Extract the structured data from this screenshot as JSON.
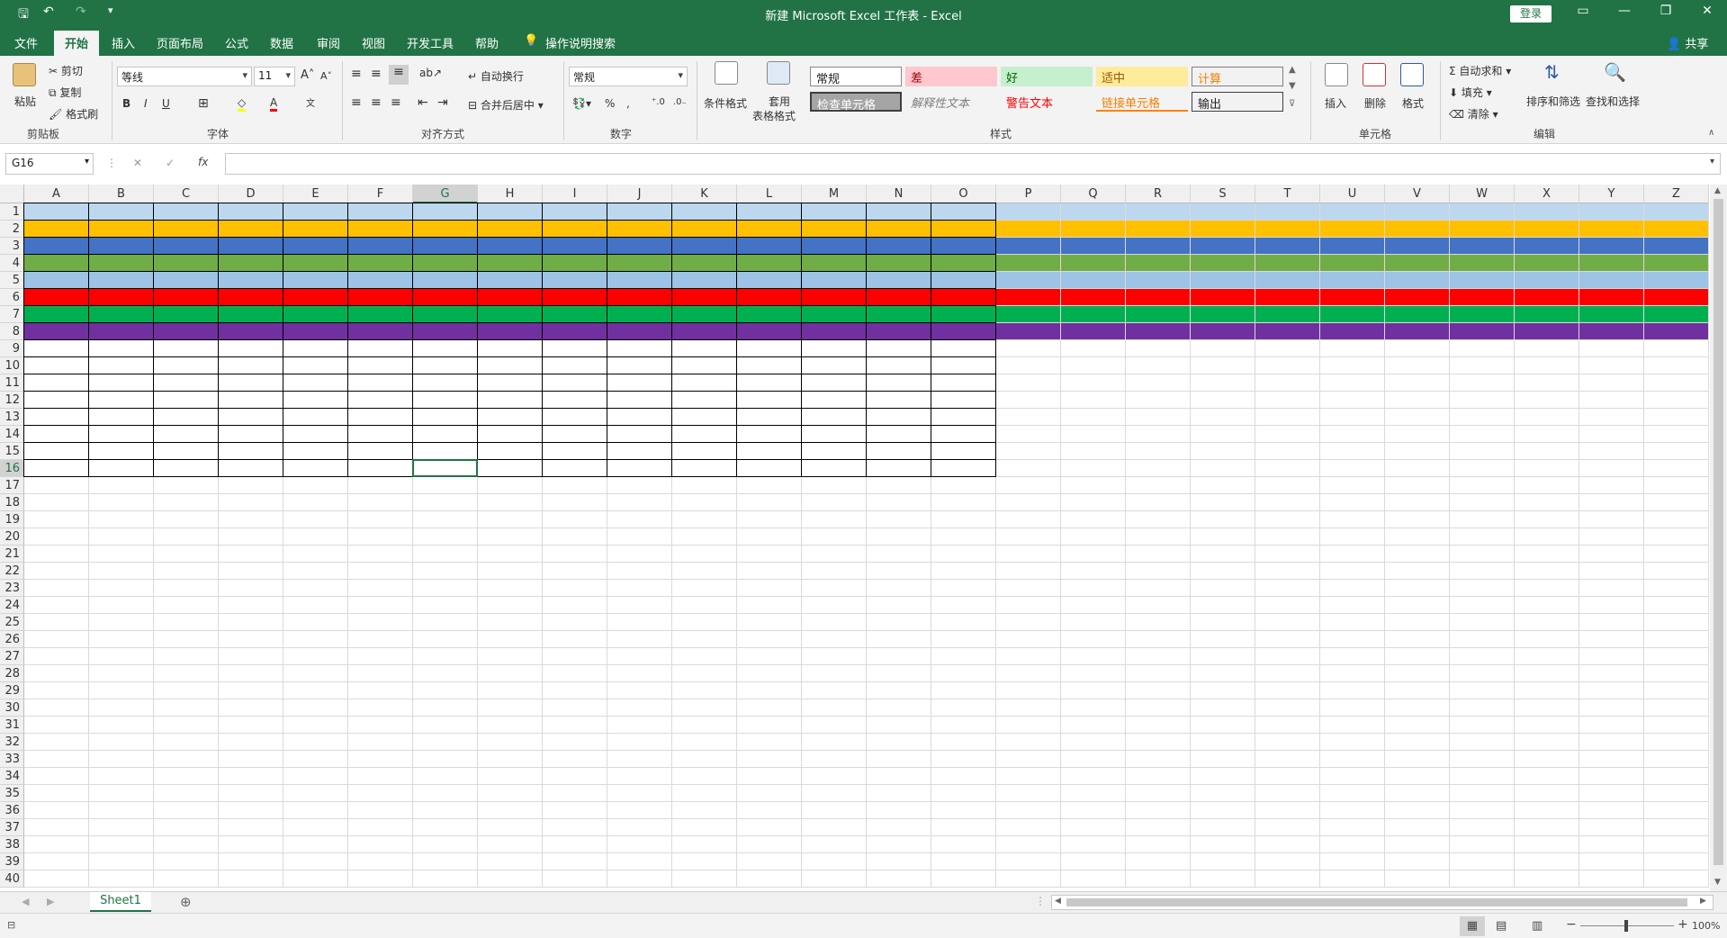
{
  "window": {
    "title": "新建 Microsoft Excel 工作表 - Excel",
    "login_label": "登录",
    "share_label": "共享"
  },
  "tabs": [
    {
      "label": "文件"
    },
    {
      "label": "开始"
    },
    {
      "label": "插入"
    },
    {
      "label": "页面布局"
    },
    {
      "label": "公式"
    },
    {
      "label": "数据"
    },
    {
      "label": "审阅"
    },
    {
      "label": "视图"
    },
    {
      "label": "开发工具"
    },
    {
      "label": "帮助"
    }
  ],
  "tell_me": "操作说明搜索",
  "ribbon": {
    "clipboard": {
      "paste": "粘贴",
      "cut": "剪切",
      "copy": "复制",
      "format_painter": "格式刷",
      "label": "剪贴板"
    },
    "font": {
      "name": "等线",
      "size": "11",
      "label": "字体",
      "bold": "B",
      "italic": "I",
      "underline": "U"
    },
    "alignment": {
      "wrap": "自动换行",
      "merge": "合并后居中",
      "label": "对齐方式"
    },
    "number": {
      "format": "常规",
      "percent": "%",
      "comma": ",",
      "label": "数字"
    },
    "styles": {
      "conditional": "条件格式",
      "table_format_line1": "套用",
      "table_format_line2": "表格格式",
      "label": "样式",
      "items": [
        "常规",
        "差",
        "好",
        "适中",
        "计算",
        "检查单元格",
        "解释性文本",
        "警告文本",
        "链接单元格",
        "输出"
      ]
    },
    "cells": {
      "insert": "插入",
      "delete": "删除",
      "format": "格式",
      "label": "单元格"
    },
    "editing": {
      "autosum": "自动求和",
      "fill": "填充",
      "clear": "清除",
      "sort": "排序和筛选",
      "find": "查找和选择",
      "label": "编辑"
    }
  },
  "formula_bar": {
    "name_box": "G16",
    "cancel": "✕",
    "enter": "✓",
    "fx": "fx",
    "content": ""
  },
  "grid": {
    "columns": [
      "A",
      "B",
      "C",
      "D",
      "E",
      "F",
      "G",
      "H",
      "I",
      "J",
      "K",
      "L",
      "M",
      "N",
      "O",
      "P",
      "Q",
      "R",
      "S",
      "T",
      "U",
      "V",
      "W",
      "X",
      "Y",
      "Z"
    ],
    "rows": [
      "1",
      "2",
      "3",
      "4",
      "5",
      "6",
      "7",
      "8",
      "9",
      "10",
      "11",
      "12",
      "13",
      "14",
      "15",
      "16",
      "17",
      "18",
      "19",
      "20",
      "21",
      "22",
      "23",
      "24",
      "25",
      "26",
      "27",
      "28",
      "29",
      "30",
      "31",
      "32",
      "33",
      "34",
      "35",
      "36",
      "37",
      "38",
      "39",
      "40"
    ],
    "selected_cell": "G16",
    "row_fills": [
      "#bdd7ee",
      "#ffc000",
      "#4472c4",
      "#70ad47",
      "#9dc3e6",
      "#ff0000",
      "#00b050",
      "#7030a0"
    ]
  },
  "sheets": [
    {
      "name": "Sheet1"
    }
  ],
  "status": {
    "zoom": "100%"
  }
}
